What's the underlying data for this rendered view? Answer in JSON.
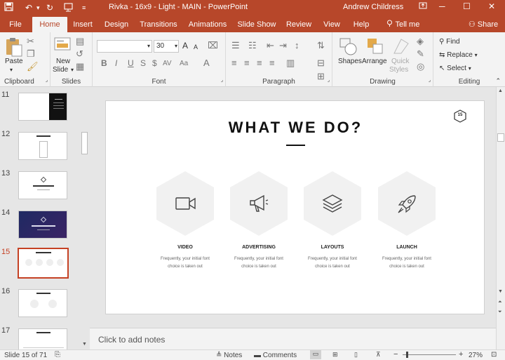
{
  "titlebar": {
    "title": "Rivka - 16x9 - Light - MAIN  -  PowerPoint",
    "user": "Andrew Childress",
    "colors": {
      "accent": "#b7472a",
      "selection": "#c54124"
    }
  },
  "tabs": [
    {
      "label": "File"
    },
    {
      "label": "Home"
    },
    {
      "label": "Insert"
    },
    {
      "label": "Design"
    },
    {
      "label": "Transitions"
    },
    {
      "label": "Animations"
    },
    {
      "label": "Slide Show"
    },
    {
      "label": "Review"
    },
    {
      "label": "View"
    },
    {
      "label": "Help"
    },
    {
      "label": "Tell me"
    },
    {
      "label": "Share"
    }
  ],
  "ribbon": {
    "clipboard": {
      "label": "Clipboard",
      "paste": "Paste"
    },
    "slides": {
      "label": "Slides",
      "new_slide_1": "New",
      "new_slide_2": "Slide"
    },
    "font": {
      "label": "Font",
      "size": "30",
      "bold": "B",
      "italic": "I",
      "underline": "U",
      "strike": "S",
      "shadow": "$",
      "spacing": "AV",
      "case": "Aa",
      "grow": "A",
      "shrink": "A"
    },
    "paragraph": {
      "label": "Paragraph"
    },
    "drawing": {
      "label": "Drawing",
      "shapes": "Shapes",
      "arrange": "Arrange",
      "quick_1": "Quick",
      "quick_2": "Styles"
    },
    "editing": {
      "label": "Editing",
      "find": "Find",
      "replace": "Replace",
      "select": "Select"
    }
  },
  "thumbnails": [
    {
      "num": "11"
    },
    {
      "num": "12"
    },
    {
      "num": "13"
    },
    {
      "num": "14"
    },
    {
      "num": "15"
    },
    {
      "num": "16"
    },
    {
      "num": "17"
    }
  ],
  "slide": {
    "badge": "15",
    "title": "WHAT WE DO?",
    "features": [
      {
        "icon": "video-camera-icon",
        "title": "VIDEO",
        "desc_1": "Frequently, your initial font",
        "desc_2": "choice is taken out"
      },
      {
        "icon": "megaphone-icon",
        "title": "ADVERTISING",
        "desc_1": "Frequently, your initial font",
        "desc_2": "choice is taken out"
      },
      {
        "icon": "layers-icon",
        "title": "LAYOUTS",
        "desc_1": "Frequently, your initial font",
        "desc_2": "choice is taken out"
      },
      {
        "icon": "rocket-icon",
        "title": "LAUNCH",
        "desc_1": "Frequently, your initial font",
        "desc_2": "choice is taken out"
      }
    ]
  },
  "notes": {
    "placeholder": "Click to add notes"
  },
  "status": {
    "slide_count": "Slide 15 of 71",
    "notes": "Notes",
    "comments": "Comments",
    "zoom": "27%"
  }
}
